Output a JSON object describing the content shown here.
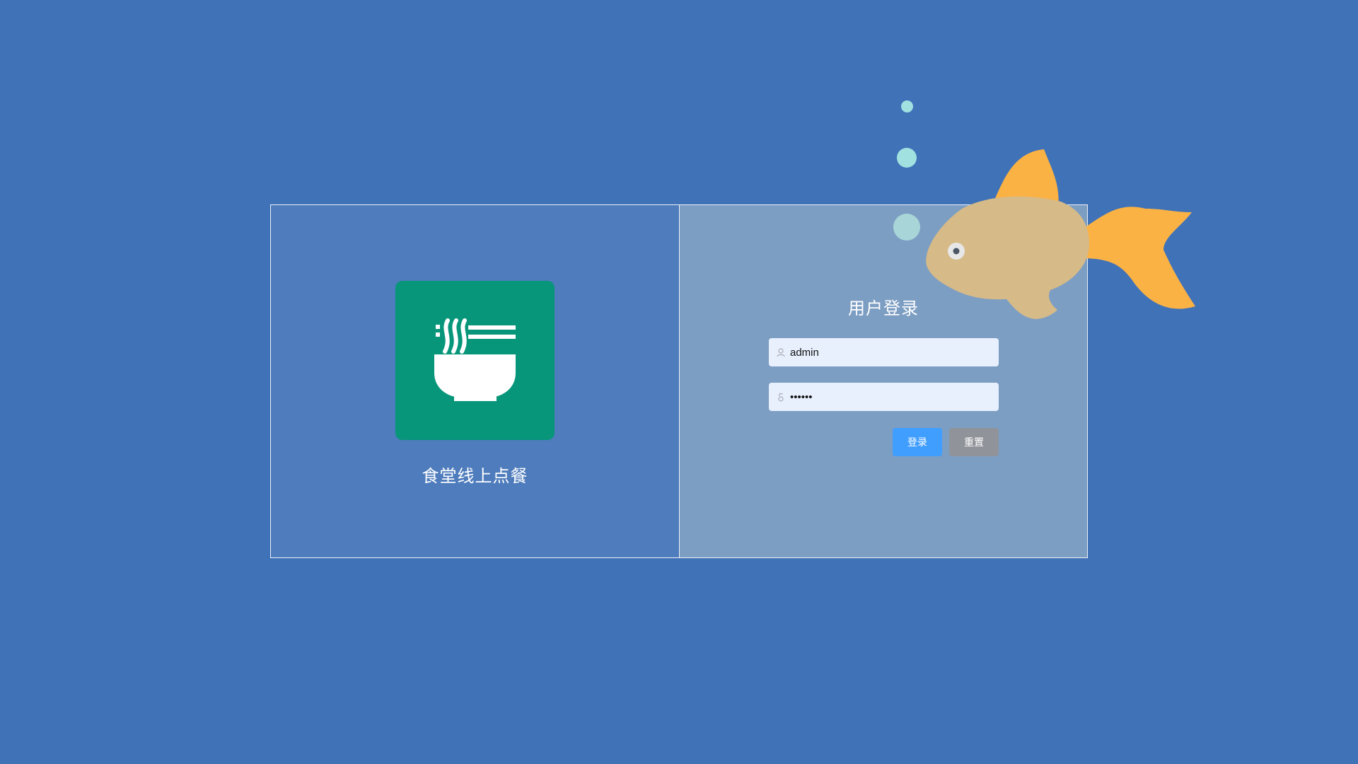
{
  "brand": {
    "app_name": "食堂线上点餐",
    "logo_icon": "noodle-bowl-icon",
    "logo_color": "#07967a"
  },
  "login": {
    "title": "用户登录",
    "username": {
      "value": "admin",
      "icon": "user-icon"
    },
    "password": {
      "value": "••••••",
      "icon": "lock-icon"
    },
    "buttons": {
      "login_label": "登录",
      "reset_label": "重置"
    }
  },
  "colors": {
    "background": "#4072b8",
    "left_panel": "#4e7cbc",
    "right_panel": "#7d9ec3",
    "primary_button": "#409eff",
    "secondary_button": "#909399",
    "fish_body": "#d6ba88",
    "fish_fin": "#fbb244",
    "bubble": "#a1e2e1"
  },
  "decoration": {
    "fish_icon": "goldfish-icon",
    "bubble_icon": "bubble-icon"
  }
}
